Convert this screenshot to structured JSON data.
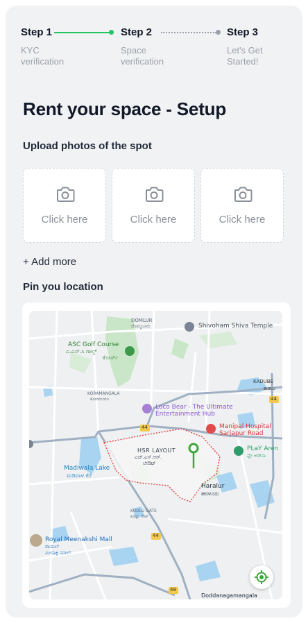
{
  "stepper": {
    "steps": [
      {
        "title": "Step 1",
        "subtitle": "KYC\nverification",
        "status": "done"
      },
      {
        "title": "Step 2",
        "subtitle": "Space\nverification",
        "status": "current"
      },
      {
        "title": "Step 3",
        "subtitle": "Let's Get\nStarted!",
        "status": "pending"
      }
    ]
  },
  "page": {
    "title": "Rent your space - Setup"
  },
  "upload": {
    "label": "Upload photos of the spot",
    "tiles": [
      {
        "text": "Click here",
        "icon": "camera-icon"
      },
      {
        "text": "Click here",
        "icon": "camera-icon"
      },
      {
        "text": "Click here",
        "icon": "camera-icon"
      }
    ],
    "add_more": "+ Add more"
  },
  "location": {
    "label": "Pin you location",
    "map": {
      "labels": {
        "domlur": "DOMLUR",
        "domlur_kn": "ದೊಮ್ಮಲೂರು",
        "shivoham": "Shivoham Shiva Temple",
        "asc_golf": "ASC Golf Course",
        "asc_golf_kn": "ಎ.ಎಸ್.ಸಿ ಗಾಲ್ಫ್",
        "asc_golf_kn2": "ಕೋರ್ಸ್",
        "kadube": "KADUBE",
        "kadube_kn": "ಕಾಡುಬ",
        "koramangala": "KORAMANGALA",
        "koramangala_kn": "ಕೋರಮಂಗಲ",
        "loco_bear": "Loco Bear - The Ultimate",
        "loco_bear2": "Entertainment Hub",
        "manipal": "Manipal Hospital",
        "manipal2": "Sarjapur Road",
        "play": "PLaY Aren",
        "play_kn": "ಪ್ಲೇ ಅರೇನಾ",
        "hsr": "HSR LAYOUT",
        "hsr_kn": "ಎಚ್.ಎಸ್.ಆರ್.",
        "hsr_kn2": "ಲೇಔಟ್",
        "madiwala": "Madiwala Lake",
        "madiwala_kn": "ಮಡಿವಾಳ ಕೆರೆ",
        "haralur": "Haralur",
        "haralur_kn": "ಹರಳೂರು",
        "kudlu": "KUDLU GATE",
        "kudlu_kn": "ಕೂಡ್ಲು ಗೇಟ್",
        "meenakshi": "Royal Meenakshi Mall",
        "meenakshi_kn": "ರಾಯಲ್",
        "meenakshi_kn2": "ಮೀನಾಕ್ಷಿ ಮಾಲ್",
        "dodda": "Doddanagamangala",
        "road44a": "44",
        "road44b": "44",
        "road44c": "44",
        "road48": "48"
      }
    }
  },
  "colors": {
    "accent_green": "#22c55e",
    "pin_green": "#3ea639",
    "muted": "#9aa1ab",
    "title": "#111827",
    "water": "#a8d4f2",
    "park": "#c9e7c8",
    "boundary": "#e34b4b"
  }
}
